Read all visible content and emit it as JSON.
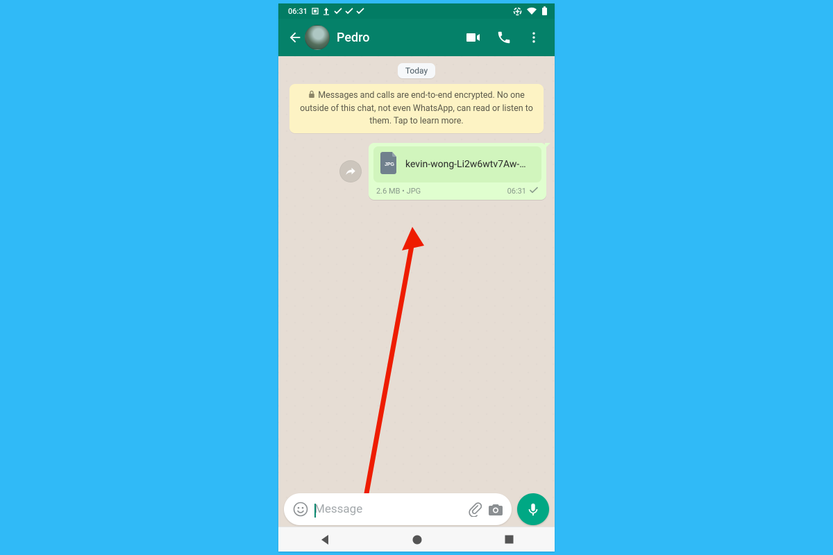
{
  "statusbar": {
    "time": "06:31"
  },
  "header": {
    "contact_name": "Pedro"
  },
  "chat": {
    "date_label": "Today",
    "encryption_notice": "Messages and calls are end-to-end encrypted. No one outside of this chat, not even WhatsApp, can read or listen to them. Tap to learn more.",
    "message": {
      "file_name": "kevin-wong-Li2w6wtv7Aw-…",
      "file_badge": "JPG",
      "file_size": "2.6 MB",
      "file_ext": "JPG",
      "time": "06:31"
    }
  },
  "composer": {
    "placeholder": "Message"
  }
}
